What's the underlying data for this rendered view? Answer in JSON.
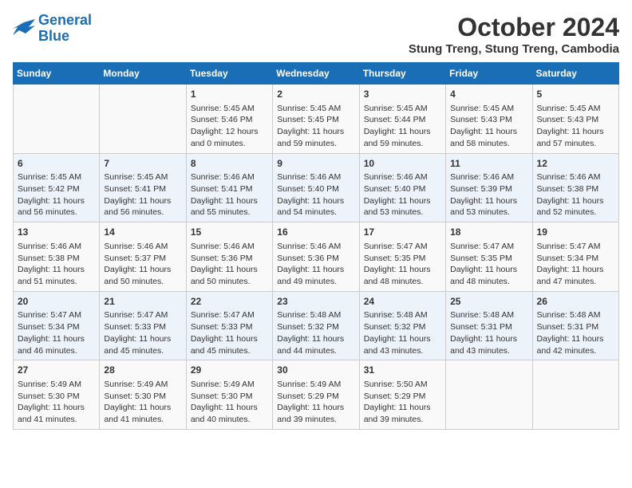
{
  "header": {
    "logo_line1": "General",
    "logo_line2": "Blue",
    "month": "October 2024",
    "location": "Stung Treng, Stung Treng, Cambodia"
  },
  "days_of_week": [
    "Sunday",
    "Monday",
    "Tuesday",
    "Wednesday",
    "Thursday",
    "Friday",
    "Saturday"
  ],
  "weeks": [
    [
      {
        "day": "",
        "info": ""
      },
      {
        "day": "",
        "info": ""
      },
      {
        "day": "1",
        "info": "Sunrise: 5:45 AM\nSunset: 5:46 PM\nDaylight: 12 hours\nand 0 minutes."
      },
      {
        "day": "2",
        "info": "Sunrise: 5:45 AM\nSunset: 5:45 PM\nDaylight: 11 hours\nand 59 minutes."
      },
      {
        "day": "3",
        "info": "Sunrise: 5:45 AM\nSunset: 5:44 PM\nDaylight: 11 hours\nand 59 minutes."
      },
      {
        "day": "4",
        "info": "Sunrise: 5:45 AM\nSunset: 5:43 PM\nDaylight: 11 hours\nand 58 minutes."
      },
      {
        "day": "5",
        "info": "Sunrise: 5:45 AM\nSunset: 5:43 PM\nDaylight: 11 hours\nand 57 minutes."
      }
    ],
    [
      {
        "day": "6",
        "info": "Sunrise: 5:45 AM\nSunset: 5:42 PM\nDaylight: 11 hours\nand 56 minutes."
      },
      {
        "day": "7",
        "info": "Sunrise: 5:45 AM\nSunset: 5:41 PM\nDaylight: 11 hours\nand 56 minutes."
      },
      {
        "day": "8",
        "info": "Sunrise: 5:46 AM\nSunset: 5:41 PM\nDaylight: 11 hours\nand 55 minutes."
      },
      {
        "day": "9",
        "info": "Sunrise: 5:46 AM\nSunset: 5:40 PM\nDaylight: 11 hours\nand 54 minutes."
      },
      {
        "day": "10",
        "info": "Sunrise: 5:46 AM\nSunset: 5:40 PM\nDaylight: 11 hours\nand 53 minutes."
      },
      {
        "day": "11",
        "info": "Sunrise: 5:46 AM\nSunset: 5:39 PM\nDaylight: 11 hours\nand 53 minutes."
      },
      {
        "day": "12",
        "info": "Sunrise: 5:46 AM\nSunset: 5:38 PM\nDaylight: 11 hours\nand 52 minutes."
      }
    ],
    [
      {
        "day": "13",
        "info": "Sunrise: 5:46 AM\nSunset: 5:38 PM\nDaylight: 11 hours\nand 51 minutes."
      },
      {
        "day": "14",
        "info": "Sunrise: 5:46 AM\nSunset: 5:37 PM\nDaylight: 11 hours\nand 50 minutes."
      },
      {
        "day": "15",
        "info": "Sunrise: 5:46 AM\nSunset: 5:36 PM\nDaylight: 11 hours\nand 50 minutes."
      },
      {
        "day": "16",
        "info": "Sunrise: 5:46 AM\nSunset: 5:36 PM\nDaylight: 11 hours\nand 49 minutes."
      },
      {
        "day": "17",
        "info": "Sunrise: 5:47 AM\nSunset: 5:35 PM\nDaylight: 11 hours\nand 48 minutes."
      },
      {
        "day": "18",
        "info": "Sunrise: 5:47 AM\nSunset: 5:35 PM\nDaylight: 11 hours\nand 48 minutes."
      },
      {
        "day": "19",
        "info": "Sunrise: 5:47 AM\nSunset: 5:34 PM\nDaylight: 11 hours\nand 47 minutes."
      }
    ],
    [
      {
        "day": "20",
        "info": "Sunrise: 5:47 AM\nSunset: 5:34 PM\nDaylight: 11 hours\nand 46 minutes."
      },
      {
        "day": "21",
        "info": "Sunrise: 5:47 AM\nSunset: 5:33 PM\nDaylight: 11 hours\nand 45 minutes."
      },
      {
        "day": "22",
        "info": "Sunrise: 5:47 AM\nSunset: 5:33 PM\nDaylight: 11 hours\nand 45 minutes."
      },
      {
        "day": "23",
        "info": "Sunrise: 5:48 AM\nSunset: 5:32 PM\nDaylight: 11 hours\nand 44 minutes."
      },
      {
        "day": "24",
        "info": "Sunrise: 5:48 AM\nSunset: 5:32 PM\nDaylight: 11 hours\nand 43 minutes."
      },
      {
        "day": "25",
        "info": "Sunrise: 5:48 AM\nSunset: 5:31 PM\nDaylight: 11 hours\nand 43 minutes."
      },
      {
        "day": "26",
        "info": "Sunrise: 5:48 AM\nSunset: 5:31 PM\nDaylight: 11 hours\nand 42 minutes."
      }
    ],
    [
      {
        "day": "27",
        "info": "Sunrise: 5:49 AM\nSunset: 5:30 PM\nDaylight: 11 hours\nand 41 minutes."
      },
      {
        "day": "28",
        "info": "Sunrise: 5:49 AM\nSunset: 5:30 PM\nDaylight: 11 hours\nand 41 minutes."
      },
      {
        "day": "29",
        "info": "Sunrise: 5:49 AM\nSunset: 5:30 PM\nDaylight: 11 hours\nand 40 minutes."
      },
      {
        "day": "30",
        "info": "Sunrise: 5:49 AM\nSunset: 5:29 PM\nDaylight: 11 hours\nand 39 minutes."
      },
      {
        "day": "31",
        "info": "Sunrise: 5:50 AM\nSunset: 5:29 PM\nDaylight: 11 hours\nand 39 minutes."
      },
      {
        "day": "",
        "info": ""
      },
      {
        "day": "",
        "info": ""
      }
    ]
  ]
}
